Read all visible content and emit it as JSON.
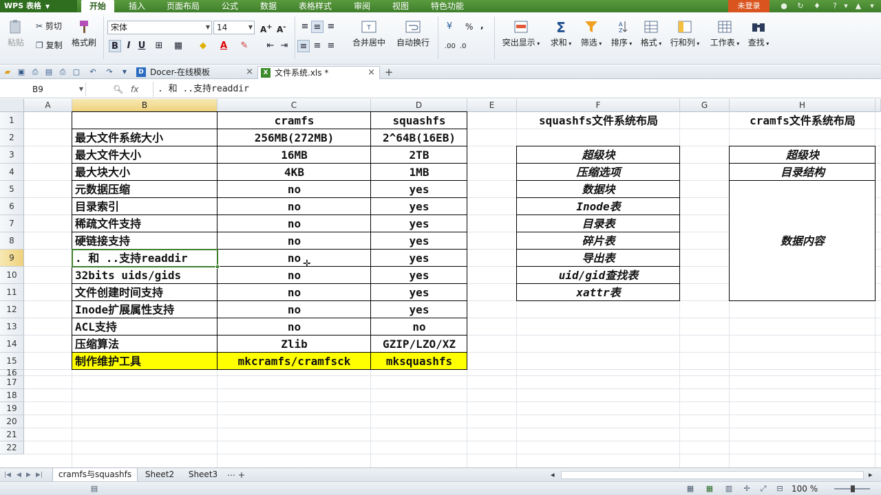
{
  "app": {
    "name": "WPS 表格",
    "login": "未登录"
  },
  "menu": [
    "开始",
    "插入",
    "页面布局",
    "公式",
    "数据",
    "表格样式",
    "审阅",
    "视图",
    "特色功能"
  ],
  "ribbon": {
    "paste": "粘贴",
    "cut": "剪切",
    "copy": "复制",
    "format_painter": "格式刷",
    "font_name": "宋体",
    "font_size": "14",
    "merge_center": "合并居中",
    "wrap_text": "自动换行",
    "highlight": "突出显示",
    "sum": "求和",
    "filter": "筛选",
    "sort": "排序",
    "format": "格式",
    "row_col": "行和列",
    "worksheet": "工作表",
    "find": "查找",
    "percent": "%",
    "comma": ","
  },
  "doc_tabs": [
    {
      "label": "Docer-在线模板"
    },
    {
      "label": "文件系统.xls *"
    }
  ],
  "formula_bar": {
    "cell_ref": "B9",
    "fx": "fx",
    "content": ". 和 ..支持readdir"
  },
  "columns": [
    "A",
    "B",
    "C",
    "D",
    "E",
    "F",
    "G",
    "H"
  ],
  "rows": [
    "1",
    "2",
    "3",
    "4",
    "5",
    "6",
    "7",
    "8",
    "9",
    "10",
    "11",
    "12",
    "13",
    "14",
    "15",
    "16",
    "17",
    "18",
    "19",
    "20",
    "21",
    "22"
  ],
  "table": {
    "header": [
      "",
      "cramfs",
      "squashfs"
    ],
    "rows": [
      [
        "最大文件系统大小",
        "256MB(272MB)",
        "2^64B(16EB)"
      ],
      [
        "最大文件大小",
        "16MB",
        "2TB"
      ],
      [
        "最大块大小",
        "4KB",
        "1MB"
      ],
      [
        "元数据压缩",
        "no",
        "yes"
      ],
      [
        "目录索引",
        "no",
        "yes"
      ],
      [
        "稀疏文件支持",
        "no",
        "yes"
      ],
      [
        "硬链接支持",
        "no",
        "yes"
      ],
      [
        ". 和 ..支持readdir",
        "no",
        "yes"
      ],
      [
        "32bits uids/gids",
        "no",
        "yes"
      ],
      [
        "文件创建时间支持",
        "no",
        "yes"
      ],
      [
        "Inode扩展属性支持",
        "no",
        "yes"
      ],
      [
        "ACL支持",
        "no",
        "no"
      ],
      [
        "压缩算法",
        "Zlib",
        "GZIP/LZO/XZ"
      ],
      [
        "制作维护工具",
        "mkcramfs/cramfsck",
        "mksquashfs"
      ]
    ]
  },
  "squashfs_layout": {
    "title": "squashfs文件系统布局",
    "items": [
      "超级块",
      "压缩选项",
      "数据块",
      "Inode表",
      "目录表",
      "碎片表",
      "导出表",
      "uid/gid查找表",
      "xattr表"
    ]
  },
  "cramfs_layout": {
    "title": "cramfs文件系统布局",
    "items": [
      "超级块",
      "目录结构"
    ],
    "content": "数据内容"
  },
  "sheets": [
    "cramfs与squashfs",
    "Sheet2",
    "Sheet3"
  ],
  "status": {
    "zoom": "100 %"
  },
  "colors": {
    "brand": "#3f7f2c",
    "highlight_yellow": "#ffff00",
    "login": "#d9541e"
  }
}
